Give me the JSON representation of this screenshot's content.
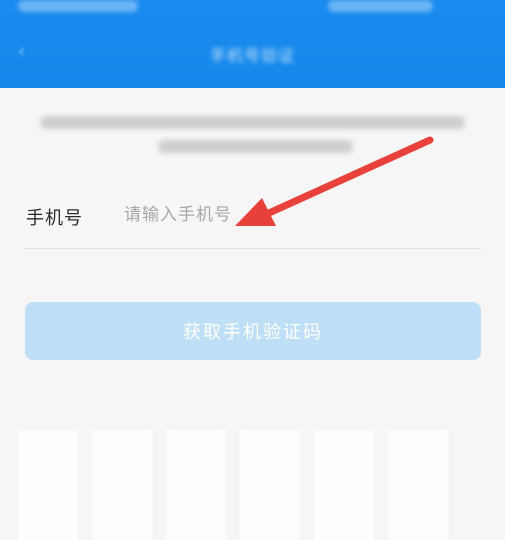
{
  "header": {
    "title": "手机号验证"
  },
  "form": {
    "phone_label": "手机号",
    "phone_placeholder": "请输入手机号",
    "phone_value": ""
  },
  "actions": {
    "get_code_label": "获取手机验证码"
  },
  "colors": {
    "primary": "#1a8cf0",
    "button_disabled": "#bfdff7",
    "annotation_arrow": "#e8413b"
  },
  "icons": {
    "back": "chevron-left-icon"
  }
}
